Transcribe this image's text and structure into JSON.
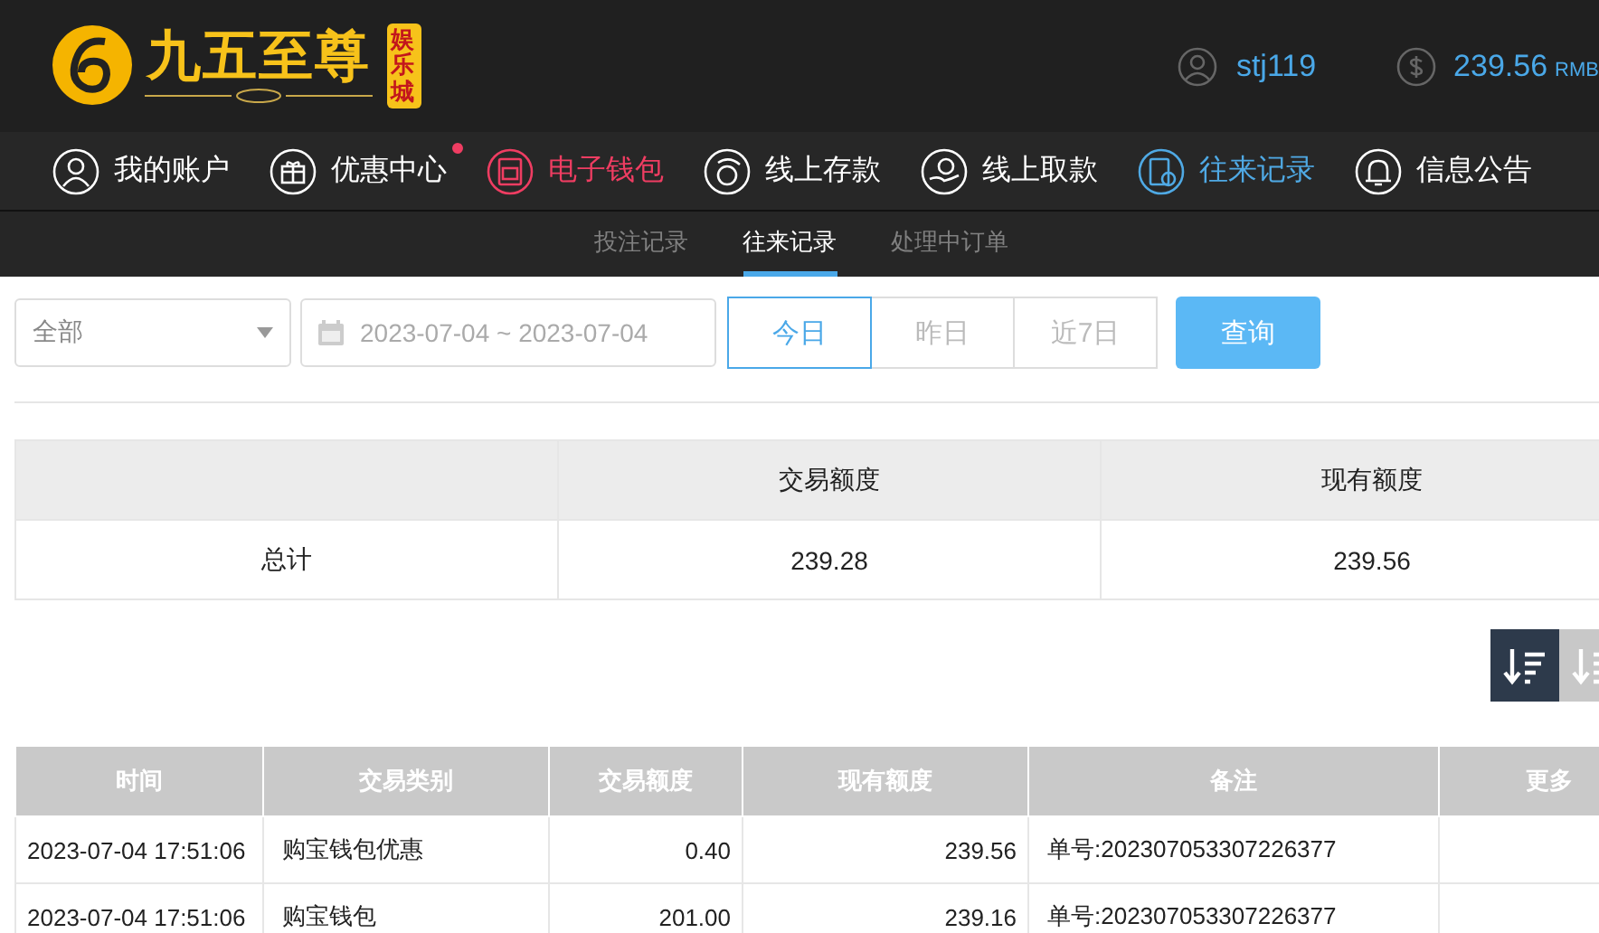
{
  "header": {
    "logo_title": "九五至尊",
    "logo_badge": "娱乐城",
    "username": "stj119",
    "balance": "239.56",
    "currency": "RMB"
  },
  "nav": [
    {
      "label": "我的账户",
      "color": "#ffffff",
      "badge": false
    },
    {
      "label": "优惠中心",
      "color": "#ffffff",
      "badge": true
    },
    {
      "label": "电子钱包",
      "color": "#ef3d62",
      "badge": false
    },
    {
      "label": "线上存款",
      "color": "#ffffff",
      "badge": false
    },
    {
      "label": "线上取款",
      "color": "#ffffff",
      "badge": false
    },
    {
      "label": "往来记录",
      "color": "#4fa9e4",
      "badge": false
    },
    {
      "label": "信息公告",
      "color": "#ffffff",
      "badge": false
    }
  ],
  "subtabs": [
    {
      "label": "投注记录",
      "selected": false
    },
    {
      "label": "往来记录",
      "selected": true
    },
    {
      "label": "处理中订单",
      "selected": false
    }
  ],
  "filters": {
    "type_select": "全部",
    "date_range": "2023-07-04 ~ 2023-07-04",
    "periods": [
      {
        "label": "今日",
        "selected": true
      },
      {
        "label": "昨日",
        "selected": false
      },
      {
        "label": "近7日",
        "selected": false
      }
    ],
    "query_button": "查询"
  },
  "summary": {
    "columns": [
      "交易额度",
      "现有额度"
    ],
    "row_label": "总计",
    "values": [
      "239.28",
      "239.56"
    ]
  },
  "sort_buttons": [
    {
      "selected": true
    },
    {
      "selected": false
    }
  ],
  "table": {
    "columns": [
      "时间",
      "交易类别",
      "交易额度",
      "现有额度",
      "备注",
      "更多"
    ],
    "rows": [
      {
        "time": "2023-07-04 17:51:06",
        "type": "购宝钱包优惠",
        "amount": "0.40",
        "balance": "239.56",
        "note": "单号:202307053307226377"
      },
      {
        "time": "2023-07-04 17:51:06",
        "type": "购宝钱包",
        "amount": "201.00",
        "balance": "239.16",
        "note": "单号:202307053307226377"
      }
    ]
  }
}
